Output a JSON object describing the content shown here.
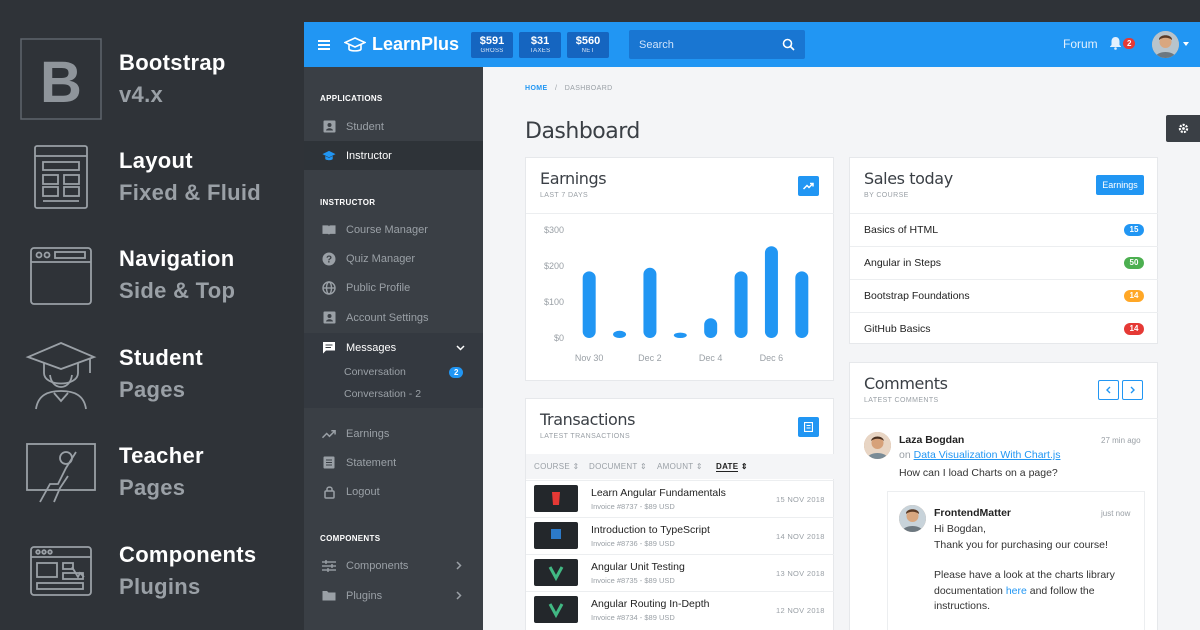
{
  "promo": [
    {
      "title": "Bootstrap",
      "sub": "v4.x",
      "icon": "bootstrap-logo-icon"
    },
    {
      "title": "Layout",
      "sub": "Fixed & Fluid",
      "icon": "layout-icon"
    },
    {
      "title": "Navigation",
      "sub": "Side & Top",
      "icon": "browser-window-icon"
    },
    {
      "title": "Student",
      "sub": "Pages",
      "icon": "student-graduate-icon"
    },
    {
      "title": "Teacher",
      "sub": "Pages",
      "icon": "teacher-board-icon"
    },
    {
      "title": "Components",
      "sub": "Plugins",
      "icon": "components-icon"
    }
  ],
  "topbar": {
    "brand": "LearnPlus",
    "stats": [
      {
        "value": "$591",
        "label": "GROSS"
      },
      {
        "value": "$31",
        "label": "TAXES"
      },
      {
        "value": "$560",
        "label": "NET"
      }
    ],
    "search_placeholder": "Search",
    "forum": "Forum",
    "notifications": "2"
  },
  "sidebar": {
    "sections": [
      "APPLICATIONS",
      "INSTRUCTOR",
      "COMPONENTS"
    ],
    "applications": [
      {
        "label": "Student",
        "icon": "id-card-icon"
      },
      {
        "label": "Instructor",
        "icon": "graduation-cap-icon"
      }
    ],
    "instructor": [
      {
        "label": "Course Manager",
        "icon": "book-icon"
      },
      {
        "label": "Quiz Manager",
        "icon": "help-circle-icon"
      },
      {
        "label": "Public Profile",
        "icon": "globe-icon"
      },
      {
        "label": "Account Settings",
        "icon": "account-box-icon"
      },
      {
        "label": "Messages",
        "icon": "message-icon"
      }
    ],
    "messages_sub": [
      {
        "label": "Conversation",
        "badge": "2"
      },
      {
        "label": "Conversation - 2"
      }
    ],
    "instructor2": [
      {
        "label": "Earnings",
        "icon": "trending-up-icon"
      },
      {
        "label": "Statement",
        "icon": "receipt-icon"
      },
      {
        "label": "Logout",
        "icon": "lock-icon"
      }
    ],
    "components": [
      {
        "label": "Components",
        "icon": "tune-icon"
      },
      {
        "label": "Plugins",
        "icon": "folder-icon"
      }
    ]
  },
  "breadcrumb": {
    "home": "HOME",
    "sep": "/",
    "current": "DASHBOARD"
  },
  "page_title": "Dashboard",
  "earnings": {
    "title": "Earnings",
    "sub": "LAST 7 DAYS"
  },
  "chart_data": {
    "type": "bar",
    "categories": [
      "Nov 30",
      "",
      "Dec 2",
      "",
      "Dec 4",
      "",
      "Dec 6",
      ""
    ],
    "values": [
      185,
      20,
      195,
      15,
      55,
      185,
      255,
      185
    ],
    "x_tick_labels": [
      "Nov 30",
      "Dec 2",
      "Dec 4",
      "Dec 6"
    ],
    "y_tick_labels": [
      "$300",
      "$200",
      "$100",
      "$0"
    ],
    "ylim": [
      0,
      300
    ],
    "grid": false,
    "color": "#2196f3"
  },
  "sales": {
    "title": "Sales today",
    "sub": "BY COURSE",
    "button": "Earnings",
    "rows": [
      {
        "name": "Basics of HTML",
        "count": "15",
        "color": "#2196f3"
      },
      {
        "name": "Angular in Steps",
        "count": "50",
        "color": "#4caf50"
      },
      {
        "name": "Bootstrap Foundations",
        "count": "14",
        "color": "#ffa726"
      },
      {
        "name": "GitHub Basics",
        "count": "14",
        "color": "#e53935"
      }
    ]
  },
  "transactions": {
    "title": "Transactions",
    "sub": "LATEST TRANSACTIONS",
    "columns": [
      "COURSE",
      "DOCUMENT",
      "AMOUNT",
      "DATE"
    ],
    "rows": [
      {
        "name": "Learn Angular Fundamentals",
        "invoice": "Invoice #8737 - $89 USD",
        "date": "15 NOV 2018"
      },
      {
        "name": "Introduction to TypeScript",
        "invoice": "Invoice #8736 - $89 USD",
        "date": "14 NOV 2018"
      },
      {
        "name": "Angular Unit Testing",
        "invoice": "Invoice #8735 - $89 USD",
        "date": "13 NOV 2018"
      },
      {
        "name": "Angular Routing In-Depth",
        "invoice": "Invoice #8734 - $89 USD",
        "date": "12 NOV 2018"
      }
    ]
  },
  "comments": {
    "title": "Comments",
    "sub": "LATEST COMMENTS",
    "first": {
      "name": "Laza Bogdan",
      "time": "27 min ago",
      "on": "on",
      "link": "Data Visualization With Chart.js",
      "text": "How can I load Charts on a page?"
    },
    "reply": {
      "name": "FrontendMatter",
      "time": "just now",
      "line1": "Hi Bogdan,",
      "line2": "Thank you for purchasing our course!",
      "line3": "Please have a look at the charts library",
      "line4a": "documentation",
      "line4link": "here",
      "line4b": "and follow the",
      "line5": "instructions."
    }
  }
}
